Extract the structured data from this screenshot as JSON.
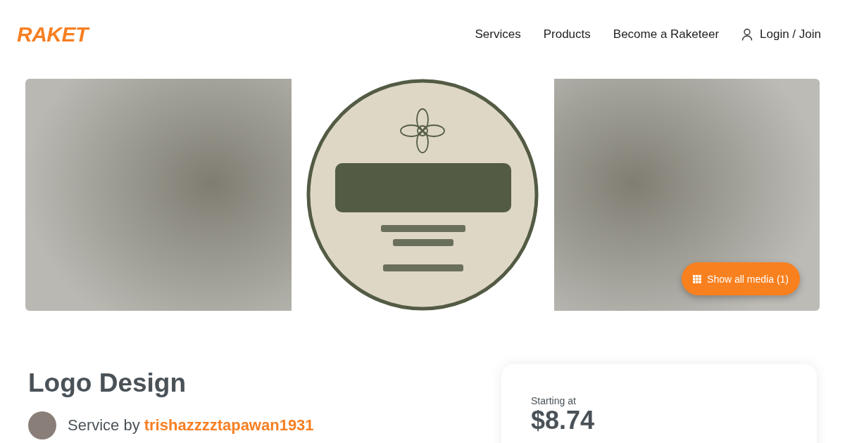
{
  "header": {
    "brand": "RAKET",
    "nav": [
      "Services",
      "Products",
      "Become a Raketeer"
    ],
    "login": "Login / Join"
  },
  "gallery": {
    "media_button": "Show all media (1)"
  },
  "service": {
    "title": "Logo Design",
    "seller_prefix": "Service by",
    "seller": "trishazzzztapawan1931"
  },
  "pricing": {
    "label": "Starting at",
    "price": "$8.74"
  }
}
